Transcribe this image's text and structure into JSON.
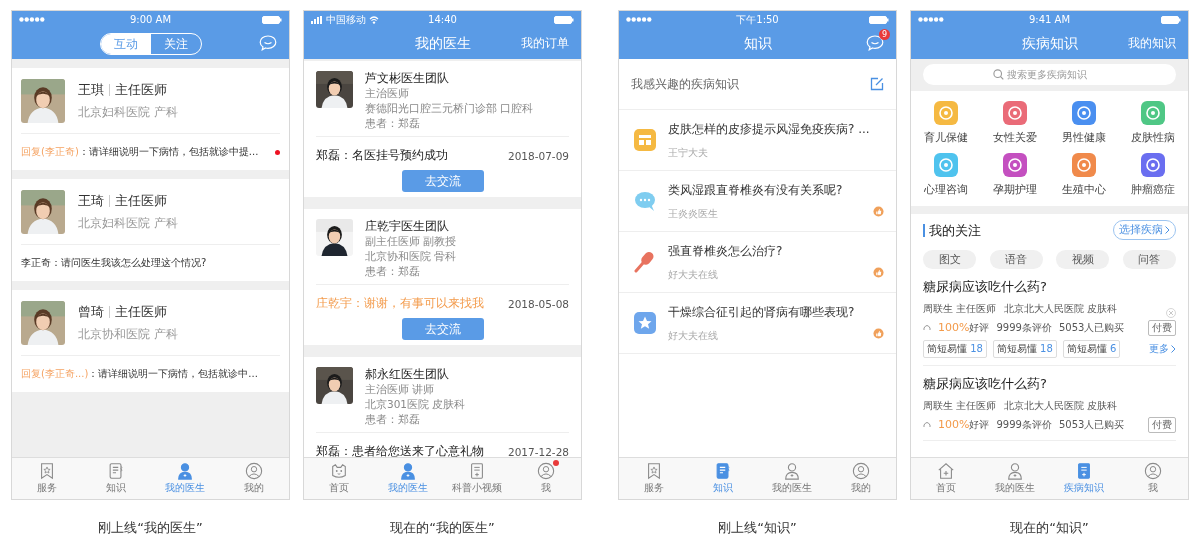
{
  "screens": [
    {
      "kind": "doctors_v1",
      "caption": "刚上线“我的医生”",
      "status_bar": {
        "time": "9:00 AM"
      },
      "segments": [
        {
          "label": "互动",
          "selected": true
        },
        {
          "label": "关注",
          "selected": false
        }
      ],
      "doctors": [
        {
          "name": "王琪",
          "title": "主任医师",
          "hospital": "北京妇科医院 产科",
          "reply": "回复(李正奇)",
          "message": "：请详细说明一下病情，包括就诊中提...",
          "unread": true
        },
        {
          "name": "王琦",
          "title": "主任医师",
          "hospital": "北京妇科医院 产科",
          "message": "李正奇：请问医生我该怎么处理这个情况?",
          "unread": false
        },
        {
          "name": "曾琦",
          "title": "主任医师",
          "hospital": "北京协和医院 产科",
          "reply": "回复(李正奇...)",
          "message": "：请详细说明一下病情，包括就诊中...",
          "unread": false
        }
      ],
      "tabs": [
        {
          "label": "服务",
          "selected": false
        },
        {
          "label": "知识",
          "selected": false
        },
        {
          "label": "我的医生",
          "selected": true
        },
        {
          "label": "我的",
          "selected": false
        }
      ]
    },
    {
      "kind": "doctors_v2",
      "caption": "现在的“我的医生”",
      "status_bar": {
        "carrier": "中国移动",
        "time": "14:40"
      },
      "title": "我的医生",
      "action": "我的订单",
      "teams": [
        {
          "name": "芦文彬医生团队",
          "lines": [
            "主治医师",
            "赛德阳光口腔三元桥门诊部 口腔科",
            "患者：郑磊"
          ],
          "message": "郑磊：名医挂号预约成功",
          "highlight": false,
          "date": "2018-07-09",
          "button": "去交流"
        },
        {
          "name": "庄乾宇医生团队",
          "lines": [
            "副主任医师 副教授",
            "北京协和医院 骨科",
            "患者：郑磊"
          ],
          "message": "庄乾宇：谢谢，有事可以来找我",
          "highlight": true,
          "date": "2018-05-08",
          "button": "去交流"
        },
        {
          "name": "郝永红医生团队",
          "lines": [
            "主治医师 讲师",
            "北京301医院 皮肤科",
            "患者：郑磊"
          ],
          "message": "郑磊：患者给您送来了心意礼物",
          "highlight": false,
          "date": "2017-12-28"
        }
      ],
      "tabs": [
        {
          "label": "首页",
          "selected": false,
          "badge": false
        },
        {
          "label": "我的医生",
          "selected": true,
          "badge": false
        },
        {
          "label": "科普小视频",
          "selected": false,
          "badge": false
        },
        {
          "label": "我",
          "selected": false,
          "badge": true
        }
      ]
    },
    {
      "kind": "knowledge_v1",
      "caption": "刚上线“知识”",
      "status_bar": {
        "time": "下午1:50"
      },
      "title": "知识",
      "badge": "9",
      "section": "我感兴趣的疾病知识",
      "articles": [
        {
          "title": "皮肤怎样的皮疹提示风湿免疫疾病? ...",
          "source": "王宁大夫",
          "liked": false
        },
        {
          "title": "类风湿跟直脊椎炎有没有关系呢?",
          "source": "王炎炎医生",
          "liked": true
        },
        {
          "title": "强直脊椎炎怎么治疗?",
          "source": "好大夫在线",
          "liked": true
        },
        {
          "title": "干燥综合征引起的肾病有哪些表现?",
          "source": "好大夫在线",
          "liked": true
        }
      ],
      "tabs": [
        {
          "label": "服务",
          "selected": false
        },
        {
          "label": "知识",
          "selected": true
        },
        {
          "label": "我的医生",
          "selected": false
        },
        {
          "label": "我的",
          "selected": false
        }
      ]
    },
    {
      "kind": "knowledge_v2",
      "caption": "现在的“知识”",
      "status_bar": {
        "time": "9:41 AM"
      },
      "title": "疾病知识",
      "action": "我的知识",
      "search": {
        "placeholder": "搜索更多疾病知识"
      },
      "categories": [
        {
          "label": "育儿保健",
          "color": "#f5b942"
        },
        {
          "label": "女性关爱",
          "color": "#ea6b78"
        },
        {
          "label": "男性健康",
          "color": "#4a8ff0"
        },
        {
          "label": "皮肤性病",
          "color": "#4fc785"
        },
        {
          "label": "心理咨询",
          "color": "#4fc3ee"
        },
        {
          "label": "孕期护理",
          "color": "#c450c0"
        },
        {
          "label": "生殖中心",
          "color": "#f08a4b"
        },
        {
          "label": "肿瘤癌症",
          "color": "#6a6ef0"
        }
      ],
      "section": "我的关注",
      "section_action": "选择疾病",
      "filters": [
        "图文",
        "语音",
        "视频",
        "问答"
      ],
      "cards": [
        {
          "title": "糖尿病应该吃什么药?",
          "doctor": "周联生 主任医师",
          "hospital": "北京北大人民医院 皮肤科",
          "rating": "100%",
          "rating_label": "好评",
          "reviews": "9999条评价",
          "purchases": "5053人已购买",
          "badge": "付费",
          "closable": true,
          "tags": [
            {
              "label": "简短易懂",
              "count": "18"
            },
            {
              "label": "简短易懂",
              "count": "18"
            },
            {
              "label": "简短易懂",
              "count": "6"
            }
          ],
          "more": "更多"
        },
        {
          "title": "糖尿病应该吃什么药?",
          "doctor": "周联生 主任医师",
          "hospital": "北京北大人民医院 皮肤科",
          "rating": "100%",
          "rating_label": "好评",
          "reviews": "9999条评价",
          "purchases": "5053人已购买",
          "badge": "付费",
          "closable": false
        }
      ],
      "tabs": [
        {
          "label": "首页",
          "selected": false
        },
        {
          "label": "我的医生",
          "selected": false
        },
        {
          "label": "疾病知识",
          "selected": true
        },
        {
          "label": "我",
          "selected": false
        }
      ]
    }
  ]
}
